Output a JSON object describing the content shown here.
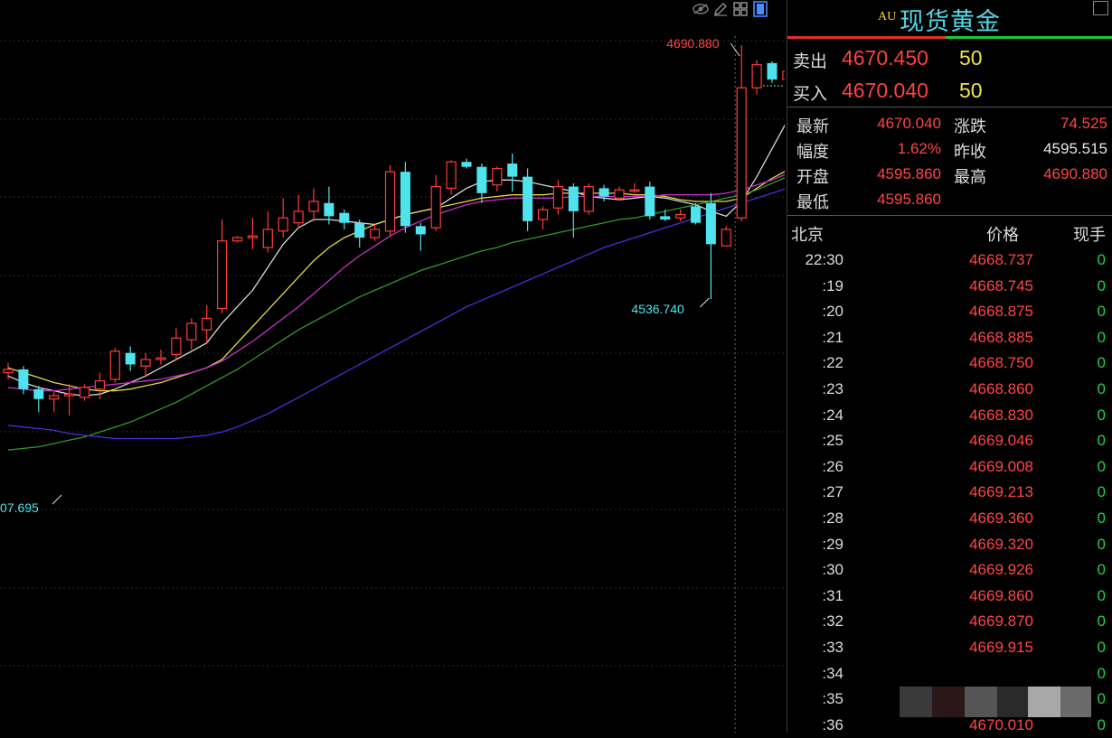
{
  "chart_data": {
    "type": "candlestick",
    "annotations": {
      "high_label": "4690.880",
      "low_label": "4536.740",
      "left_label": "07.695"
    },
    "candles": [
      {
        "o": 4492,
        "c": 4494,
        "h": 4498,
        "l": 4488
      },
      {
        "o": 4494,
        "c": 4482,
        "h": 4496,
        "l": 4479
      },
      {
        "o": 4482,
        "c": 4476,
        "h": 4484,
        "l": 4468
      },
      {
        "o": 4476,
        "c": 4478,
        "h": 4480,
        "l": 4468
      },
      {
        "o": 4478,
        "c": 4479,
        "h": 4485,
        "l": 4466
      },
      {
        "o": 4477,
        "c": 4483,
        "h": 4485,
        "l": 4475
      },
      {
        "o": 4482,
        "c": 4487,
        "h": 4492,
        "l": 4476
      },
      {
        "o": 4488,
        "c": 4505,
        "h": 4507,
        "l": 4486
      },
      {
        "o": 4504,
        "c": 4497,
        "h": 4508,
        "l": 4493
      },
      {
        "o": 4496,
        "c": 4500,
        "h": 4504,
        "l": 4490
      },
      {
        "o": 4500,
        "c": 4501,
        "h": 4506,
        "l": 4497
      },
      {
        "o": 4503,
        "c": 4513,
        "h": 4519,
        "l": 4500
      },
      {
        "o": 4512,
        "c": 4522,
        "h": 4525,
        "l": 4506
      },
      {
        "o": 4518,
        "c": 4525,
        "h": 4533,
        "l": 4510
      },
      {
        "o": 4531,
        "c": 4572,
        "h": 4585,
        "l": 4528
      },
      {
        "o": 4572,
        "c": 4574,
        "h": 4575,
        "l": 4571
      },
      {
        "o": 4574,
        "c": 4575,
        "h": 4586,
        "l": 4567
      },
      {
        "o": 4568,
        "c": 4579,
        "h": 4590,
        "l": 4565
      },
      {
        "o": 4578,
        "c": 4586,
        "h": 4598,
        "l": 4574
      },
      {
        "o": 4583,
        "c": 4590,
        "h": 4600,
        "l": 4580
      },
      {
        "o": 4590,
        "c": 4596,
        "h": 4604,
        "l": 4584
      },
      {
        "o": 4595,
        "c": 4587,
        "h": 4605,
        "l": 4582
      },
      {
        "o": 4589,
        "c": 4583,
        "h": 4591,
        "l": 4579
      },
      {
        "o": 4583,
        "c": 4574,
        "h": 4585,
        "l": 4568
      },
      {
        "o": 4574,
        "c": 4579,
        "h": 4582,
        "l": 4572
      },
      {
        "o": 4578,
        "c": 4614,
        "h": 4618,
        "l": 4575
      },
      {
        "o": 4614,
        "c": 4581,
        "h": 4620,
        "l": 4577
      },
      {
        "o": 4581,
        "c": 4576,
        "h": 4583,
        "l": 4566
      },
      {
        "o": 4580,
        "c": 4605,
        "h": 4612,
        "l": 4578
      },
      {
        "o": 4604,
        "c": 4620,
        "h": 4621,
        "l": 4600
      },
      {
        "o": 4620,
        "c": 4617,
        "h": 4622,
        "l": 4616
      },
      {
        "o": 4617,
        "c": 4601,
        "h": 4619,
        "l": 4595
      },
      {
        "o": 4606,
        "c": 4616,
        "h": 4617,
        "l": 4602
      },
      {
        "o": 4619,
        "c": 4611,
        "h": 4625,
        "l": 4602
      },
      {
        "o": 4611,
        "c": 4584,
        "h": 4616,
        "l": 4578
      },
      {
        "o": 4585,
        "c": 4591,
        "h": 4593,
        "l": 4579
      },
      {
        "o": 4592,
        "c": 4605,
        "h": 4609,
        "l": 4588
      },
      {
        "o": 4605,
        "c": 4590,
        "h": 4607,
        "l": 4574
      },
      {
        "o": 4590,
        "c": 4605,
        "h": 4607,
        "l": 4588
      },
      {
        "o": 4604,
        "c": 4599,
        "h": 4606,
        "l": 4596
      },
      {
        "o": 4598,
        "c": 4603,
        "h": 4605,
        "l": 4597
      },
      {
        "o": 4603,
        "c": 4603,
        "h": 4607,
        "l": 4601
      },
      {
        "o": 4605,
        "c": 4587,
        "h": 4608,
        "l": 4585
      },
      {
        "o": 4587,
        "c": 4585,
        "h": 4591,
        "l": 4584
      },
      {
        "o": 4586,
        "c": 4588,
        "h": 4591,
        "l": 4584
      },
      {
        "o": 4593,
        "c": 4583,
        "h": 4595,
        "l": 4582
      },
      {
        "o": 4595,
        "c": 4570,
        "h": 4601,
        "l": 4536.74
      },
      {
        "o": 4569,
        "c": 4579,
        "h": 4581,
        "l": 4569
      },
      {
        "o": 4586,
        "c": 4665,
        "h": 4690.88,
        "l": 4584
      },
      {
        "o": 4665,
        "c": 4679,
        "h": 4682,
        "l": 4661
      },
      {
        "o": 4680,
        "c": 4670,
        "h": 4681,
        "l": 4668
      },
      {
        "o": 4670,
        "c": 4675,
        "h": 4677,
        "l": 4665
      }
    ],
    "ma": [
      {
        "color": "#d8d8d8",
        "values": [
          4490,
          4486,
          4483,
          4481,
          4479,
          4478,
          4479,
          4482,
          4486,
          4490,
          4495,
          4500,
          4505,
          4510,
          4522,
          4532,
          4542,
          4556,
          4570,
          4580,
          4585,
          4585,
          4584,
          4583,
          4582,
          4585,
          4588,
          4590,
          4592,
          4598,
          4604,
          4608,
          4609,
          4609,
          4608,
          4606,
          4604,
          4602,
          4599,
          4598,
          4597,
          4598,
          4599,
          4598,
          4596,
          4594,
          4590,
          4587,
          4596,
          4611,
          4628,
          4645
        ]
      },
      {
        "color": "#e6d84a",
        "values": [
          4495,
          4492,
          4489,
          4486,
          4484,
          4482,
          4481,
          4481,
          4482,
          4484,
          4486,
          4489,
          4492,
          4495,
          4500,
          4510,
          4520,
          4530,
          4540,
          4550,
          4560,
          4568,
          4574,
          4578,
          4582,
          4585,
          4588,
          4590,
          4592,
          4594,
          4596,
          4598,
          4599,
          4600,
          4600,
          4600,
          4601,
          4601,
          4601,
          4601,
          4601,
          4600,
          4600,
          4599,
          4597,
          4596,
          4596,
          4596,
          4598,
          4604,
          4610,
          4615
        ]
      },
      {
        "color": "#c82fc8",
        "values": [
          4483,
          4482,
          4481,
          4481,
          4482,
          4483,
          4484,
          4485,
          4486,
          4487,
          4488,
          4490,
          4492,
          4495,
          4499,
          4505,
          4511,
          4518,
          4525,
          4532,
          4540,
          4548,
          4556,
          4563,
          4569,
          4575,
          4580,
          4584,
          4588,
          4591,
          4594,
          4596,
          4597,
          4598,
          4598,
          4598,
          4598,
          4599,
          4599,
          4599,
          4599,
          4599,
          4599,
          4600,
          4600,
          4600,
          4600,
          4601,
          4603,
          4606,
          4609,
          4613
        ]
      },
      {
        "color": "#2e9a2e",
        "values": [
          4445,
          4446,
          4447,
          4449,
          4451,
          4453,
          4456,
          4459,
          4462,
          4466,
          4470,
          4474,
          4479,
          4484,
          4489,
          4494,
          4500,
          4506,
          4512,
          4518,
          4523,
          4528,
          4533,
          4538,
          4542,
          4546,
          4550,
          4554,
          4557,
          4560,
          4563,
          4566,
          4568,
          4571,
          4573,
          4575,
          4577,
          4579,
          4581,
          4583,
          4585,
          4586,
          4588,
          4590,
          4592,
          4594,
          4596,
          4598,
          4600,
          4603,
          4607,
          4611
        ]
      },
      {
        "color": "#4a2fd6",
        "values": [
          4460,
          4459,
          4458,
          4457,
          4455,
          4454,
          4453,
          4452,
          4452,
          4452,
          4452,
          4452,
          4453,
          4454,
          4456,
          4459,
          4463,
          4467,
          4472,
          4477,
          4482,
          4487,
          4492,
          4497,
          4502,
          4507,
          4512,
          4517,
          4522,
          4527,
          4532,
          4536,
          4540,
          4544,
          4548,
          4552,
          4556,
          4560,
          4564,
          4568,
          4571,
          4574,
          4577,
          4580,
          4583,
          4586,
          4589,
          4592,
          4595,
          4598,
          4601,
          4604
        ]
      }
    ]
  },
  "toolbar": {
    "icons": [
      "eye-icon",
      "pencil-icon",
      "grid-icon",
      "panel-icon"
    ]
  },
  "quote": {
    "prefix": "AU",
    "name": "现货黄金",
    "sell_label": "卖出",
    "sell_price": "4670.450",
    "sell_vol": "50",
    "buy_label": "买入",
    "buy_price": "4670.040",
    "buy_vol": "50"
  },
  "stats": {
    "latest_label": "最新",
    "latest": "4670.040",
    "change_label": "涨跌",
    "change": "74.525",
    "range_label": "幅度",
    "range": "1.62%",
    "prev_label": "昨收",
    "prev": "4595.515",
    "open_label": "开盘",
    "open": "4595.860",
    "high_label": "最高",
    "high": "4690.880",
    "low_label": "最低",
    "low": "4595.860"
  },
  "ticks_header": {
    "time": "北京",
    "price": "价格",
    "vol": "现手"
  },
  "ticks": [
    {
      "time": "22:30",
      "price": "4668.737",
      "vol": "0"
    },
    {
      "time": ":19",
      "price": "4668.745",
      "vol": "0"
    },
    {
      "time": ":20",
      "price": "4668.875",
      "vol": "0"
    },
    {
      "time": ":21",
      "price": "4668.885",
      "vol": "0"
    },
    {
      "time": ":22",
      "price": "4668.750",
      "vol": "0"
    },
    {
      "time": ":23",
      "price": "4668.860",
      "vol": "0"
    },
    {
      "time": ":24",
      "price": "4668.830",
      "vol": "0"
    },
    {
      "time": ":25",
      "price": "4669.046",
      "vol": "0"
    },
    {
      "time": ":26",
      "price": "4669.008",
      "vol": "0"
    },
    {
      "time": ":27",
      "price": "4669.213",
      "vol": "0"
    },
    {
      "time": ":28",
      "price": "4669.360",
      "vol": "0"
    },
    {
      "time": ":29",
      "price": "4669.320",
      "vol": "0"
    },
    {
      "time": ":30",
      "price": "4669.926",
      "vol": "0"
    },
    {
      "time": ":31",
      "price": "4669.860",
      "vol": "0"
    },
    {
      "time": ":32",
      "price": "4669.870",
      "vol": "0"
    },
    {
      "time": ":33",
      "price": "4669.915",
      "vol": "0"
    },
    {
      "time": ":34",
      "price": "",
      "vol": "0"
    },
    {
      "time": ":35",
      "price": "",
      "vol": "0"
    },
    {
      "time": ":36",
      "price": "4670.010",
      "vol": "0"
    }
  ],
  "colors": {
    "up": "#ff3b3b",
    "down": "#4fe3ee",
    "grid": "#2a2a2a"
  }
}
